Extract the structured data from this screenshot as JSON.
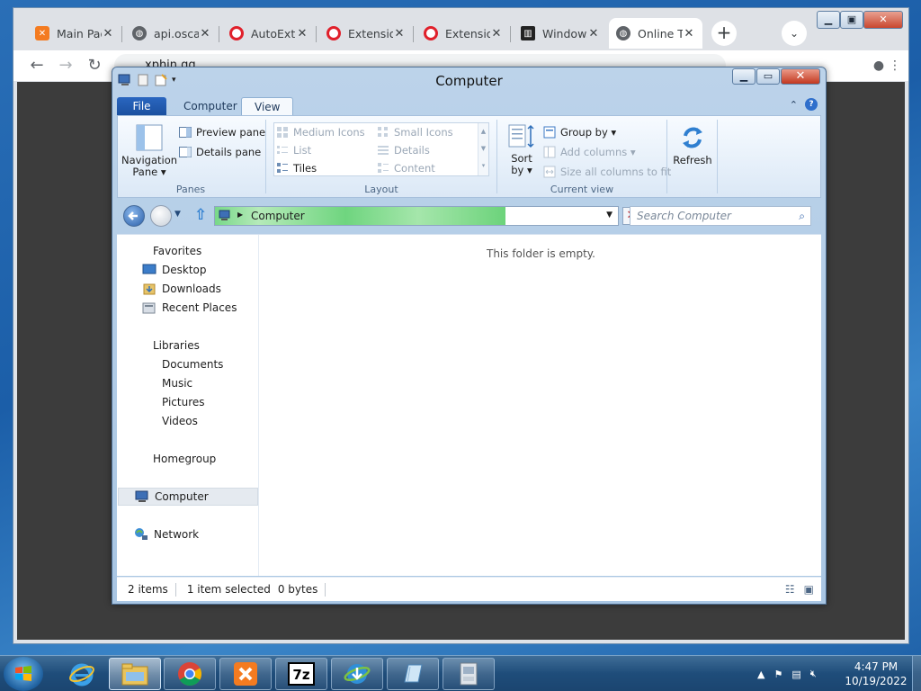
{
  "chrome": {
    "tabs": [
      {
        "title": "Main Page",
        "favicon": "xampp-icon",
        "color": "#f47b20"
      },
      {
        "title": "api.oscar",
        "favicon": "globe-icon",
        "color": "#5f6368"
      },
      {
        "title": "AutoExtend",
        "favicon": "opera-icon",
        "color": "#e0202b"
      },
      {
        "title": "Extensions",
        "favicon": "opera-icon",
        "color": "#e0202b"
      },
      {
        "title": "Extensions",
        "favicon": "opera-icon",
        "color": "#e0202b"
      },
      {
        "title": "Windows",
        "favicon": "museum-icon",
        "color": "#222222"
      },
      {
        "title": "Online T",
        "favicon": "globe-icon",
        "color": "#5f6368"
      }
    ],
    "url": "xphin.gg"
  },
  "explorer": {
    "title": "Computer",
    "ribbon_tabs": [
      "File",
      "Computer",
      "View"
    ],
    "panes": {
      "navigation_pane": "Navigation",
      "navigation_pane2": "Pane",
      "preview_pane": "Preview pane",
      "details_pane": "Details pane",
      "label": "Panes"
    },
    "layout": {
      "medium_icons": "Medium Icons",
      "small_icons": "Small Icons",
      "list": "List",
      "details": "Details",
      "tiles": "Tiles",
      "content": "Content",
      "label": "Layout"
    },
    "current_view": {
      "sort_by": "Sort",
      "sort_by2": "by",
      "group_by": "Group by",
      "add_columns": "Add columns",
      "size_all": "Size all columns to fit",
      "label": "Current view"
    },
    "refresh": "Refresh",
    "address": "Computer",
    "search_placeholder": "Search Computer",
    "nav": {
      "favorites": "Favorites",
      "desktop": "Desktop",
      "downloads": "Downloads",
      "recent_places": "Recent Places",
      "libraries": "Libraries",
      "documents": "Documents",
      "music": "Music",
      "pictures": "Pictures",
      "videos": "Videos",
      "homegroup": "Homegroup",
      "computer": "Computer",
      "network": "Network"
    },
    "empty_message": "This folder is empty.",
    "status": {
      "items": "2 items",
      "selected": "1 item selected",
      "size": "0 bytes"
    }
  },
  "taskbar": {
    "time": "4:47 PM",
    "date": "10/19/2022"
  }
}
